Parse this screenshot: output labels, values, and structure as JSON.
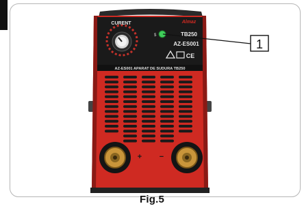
{
  "figure": {
    "caption": "Fig.5",
    "callout_number": "1"
  },
  "device": {
    "current_label": "CURENT",
    "brand": "Almaz",
    "model": "TB250",
    "code": "AZ-ES001",
    "description": "AZ-ES001 APARAT DE SUDURA TB250",
    "polarity_plus": "+",
    "polarity_minus": "−"
  },
  "colors": {
    "body_red": "#cf2a22",
    "panel_black": "#1a1a1a",
    "terminal_brass": "#c9953a",
    "indicator_green": "#3fcf5a"
  }
}
